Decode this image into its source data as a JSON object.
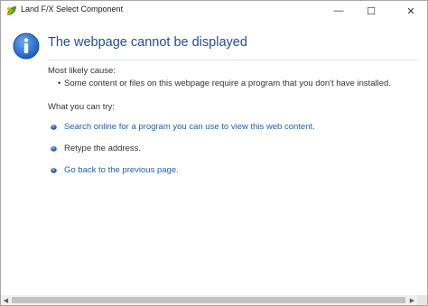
{
  "window": {
    "title": "Land F/X Select Component",
    "controls": {
      "minimize": "—",
      "maximize": "☐",
      "close": "✕"
    }
  },
  "page": {
    "heading": "The webpage cannot be displayed",
    "cause_label": "Most likely cause:",
    "causes": [
      "Some content or files on this webpage require a program that you don't have installed."
    ],
    "try_label": "What you can try:",
    "suggestions": [
      {
        "text": "Search online for a program you can use to view this web content.",
        "is_link": true
      },
      {
        "text": "Retype the address.",
        "is_link": false
      },
      {
        "text": "Go back to the previous page.",
        "is_link": true
      }
    ]
  },
  "scrollbar": {
    "left_arrow": "◀",
    "right_arrow": "▶"
  },
  "colors": {
    "heading": "#1f4e99",
    "link": "#1f5fb0",
    "info_icon": "#2a6fd0",
    "bullet": "#2d5fb5"
  },
  "icons": {
    "app": "land-fx-leaf-icon",
    "info": "info-icon",
    "bullet": "blue-bullet-icon"
  }
}
